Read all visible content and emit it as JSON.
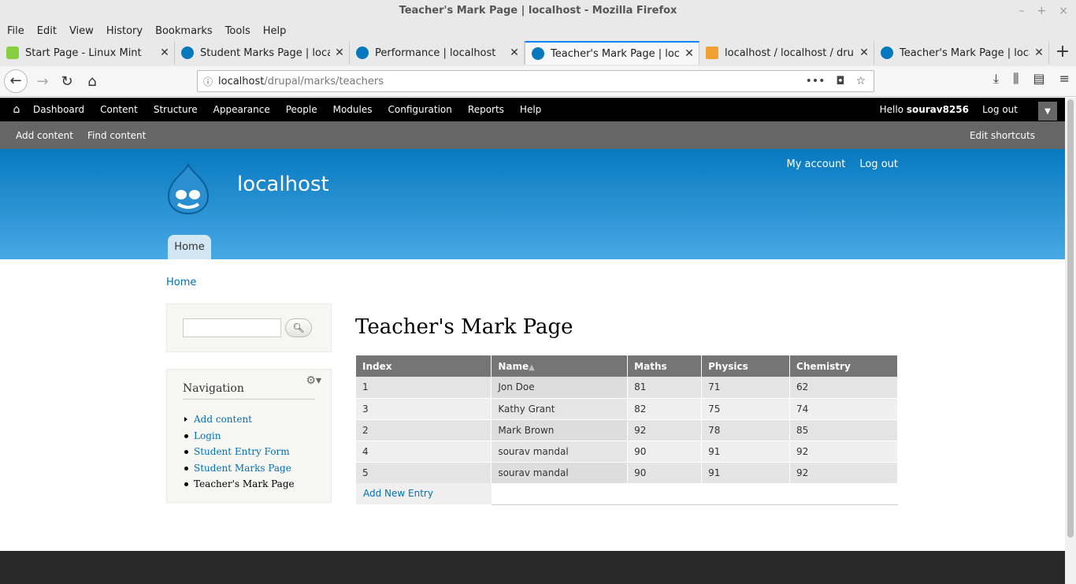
{
  "window": {
    "title": "Teacher's Mark Page | localhost - Mozilla Firefox"
  },
  "menubar": [
    "File",
    "Edit",
    "View",
    "History",
    "Bookmarks",
    "Tools",
    "Help"
  ],
  "tabs": [
    {
      "label": "Start Page - Linux Mint",
      "favicon": "linux-mint-icon"
    },
    {
      "label": "Student Marks Page | localhost",
      "favicon": "drupal-icon"
    },
    {
      "label": "Performance | localhost",
      "favicon": "drupal-icon"
    },
    {
      "label": "Teacher's Mark Page | localhost",
      "favicon": "drupal-icon"
    },
    {
      "label": "localhost / localhost / drupal",
      "favicon": "phpmyadmin-icon"
    },
    {
      "label": "Teacher's Mark Page | localhost",
      "favicon": "drupal-icon"
    }
  ],
  "url": {
    "host": "localhost",
    "path": "/drupal/marks/teachers"
  },
  "admin_toolbar": {
    "items": [
      "Dashboard",
      "Content",
      "Structure",
      "Appearance",
      "People",
      "Modules",
      "Configuration",
      "Reports",
      "Help"
    ],
    "hello_prefix": "Hello ",
    "username": "sourav8256",
    "logout": "Log out"
  },
  "shortcuts": {
    "items": [
      "Add content",
      "Find content"
    ],
    "edit": "Edit shortcuts"
  },
  "site": {
    "name": "localhost",
    "secondary_menu": [
      "My account",
      "Log out"
    ],
    "main_menu": "Home"
  },
  "breadcrumb": "Home",
  "navigation": {
    "title": "Navigation",
    "items": [
      "Add content",
      "Login",
      "Student Entry Form",
      "Student Marks Page",
      "Teacher's Mark Page"
    ]
  },
  "page_title": "Teacher's Mark Page",
  "table": {
    "headers": [
      "Index",
      "Name",
      "Maths",
      "Physics",
      "Chemistry"
    ],
    "sort_indicator": "▲",
    "rows": [
      [
        "1",
        "Jon Doe",
        "81",
        "71",
        "62"
      ],
      [
        "3",
        "Kathy Grant",
        "82",
        "75",
        "74"
      ],
      [
        "2",
        "Mark Brown",
        "92",
        "78",
        "85"
      ],
      [
        "4",
        "sourav mandal",
        "90",
        "91",
        "92"
      ],
      [
        "5",
        "sourav mandal",
        "90",
        "91",
        "92"
      ]
    ]
  },
  "add_entry": "Add New Entry",
  "colors": {
    "accent": "#0071b3",
    "header_top": "#0779bf",
    "header_bottom": "#48a9e4"
  }
}
